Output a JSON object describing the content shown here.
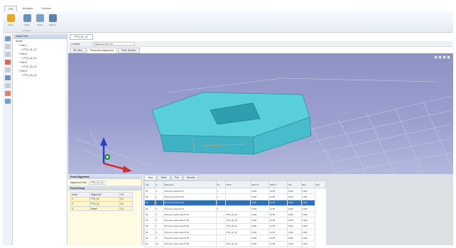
{
  "ribbon": {
    "tabs": [
      "File",
      "Analysis",
      "Options"
    ],
    "buttons": [
      {
        "label": "Open",
        "icon": "folder-icon",
        "color": "#e4a62c"
      },
      {
        "label": "Mesh",
        "icon": "mesh-icon",
        "color": "#6b8fbf"
      },
      {
        "label": "Solve",
        "icon": "solve-icon",
        "color": "#7aa0c7"
      },
      {
        "label": "Report",
        "icon": "report-icon",
        "color": "#5c7fb0"
      }
    ],
    "group_label": "Analysis"
  },
  "tree": {
    "header": "Model Tree",
    "nodes": [
      {
        "label": "Model",
        "indent": 0
      },
      {
        "label": "+ Part 1",
        "indent": 1
      },
      {
        "label": "+ PTS_01_12",
        "indent": 2
      },
      {
        "label": "+ Part 2",
        "indent": 1
      },
      {
        "label": "+ PTS_02_12",
        "indent": 2
      },
      {
        "label": "+ Part 3",
        "indent": 1
      },
      {
        "label": "+ PTS_03_12",
        "indent": 2
      },
      {
        "label": "+ Part 4",
        "indent": 1
      },
      {
        "label": "+ PTS_04_12",
        "indent": 2
      }
    ]
  },
  "document": {
    "tab_title": "PTS_01_12",
    "breadcrumb_label": "Location",
    "breadcrumb_value": "Placement PTS_01",
    "view_tabs": [
      "3D View",
      "Placement Alignment",
      "Fiber Section"
    ],
    "active_view_tab": 1
  },
  "viewport": {
    "object_color": "#49c6d3",
    "background": "#9a9fce"
  },
  "properties": {
    "section1_title": "Point Alignment",
    "row_label": "Alignment Point",
    "row_value": "PTS_01_12",
    "section2_title": "Point Group",
    "table_header": [
      "Index",
      "Alignment",
      "Off"
    ],
    "table_rows": [
      [
        "1",
        "PTS_01",
        "0.0"
      ],
      [
        "2",
        "PTS_02",
        "0.0"
      ],
      [
        "3",
        "Reset",
        "0.0"
      ]
    ]
  },
  "grid": {
    "tabs": [
      "Data",
      "Table",
      "Plot",
      "Results"
    ],
    "columns": [
      "Cat",
      "#",
      "Alignment",
      "Idx",
      "Point",
      "Offset X",
      "Offset Y",
      "Vert",
      "Elev",
      "Rot"
    ],
    "rows": [
      [
        "PA",
        "1",
        "Pressure vessel Pt 01",
        "1",
        "",
        "0.000",
        "12.55",
        "0.000",
        "0.000"
      ],
      [
        "PA",
        "2",
        "Pressure vessel Pt 02",
        "2",
        "",
        "0.000",
        "12.55",
        "0.000",
        "0.000"
      ],
      [
        "PA",
        "3",
        "Pressure vessel Pt 03",
        "3",
        "",
        "0.000",
        "12.55",
        "0.000",
        "0.000"
      ],
      [
        "PA",
        "4",
        "Pressure vessel Pt 04",
        "4",
        "",
        "0.000",
        "12.55",
        "0.000",
        "0.000"
      ],
      [
        "PA",
        "5",
        "Pressure vessel outer Pt 01",
        "",
        "PTS_01_12",
        "0.000",
        "12.55",
        "0.000",
        "0.000"
      ],
      [
        "PA",
        "6",
        "Pressure vessel outer Pt 02",
        "",
        "PTS_02_12",
        "0.000",
        "12.55",
        "0.000",
        "0.000"
      ],
      [
        "PA",
        "7",
        "Pressure vessel outer Pt 03",
        "",
        "PTS_03_12",
        "0.000",
        "12.55",
        "0.000",
        "0.000"
      ],
      [
        "PA",
        "8",
        "Pressure vessel outer Pt 04",
        "",
        "PTS_04_12",
        "0.000",
        "12.55",
        "0.000",
        "0.000"
      ],
      [
        "PA",
        "9",
        "Pressure vessel outer Pt 05",
        "",
        "",
        "0.000",
        "12.55",
        "0.000",
        "0.000"
      ],
      [
        "PA",
        "10",
        "Pressure vessel outer Pt 06",
        "",
        "PTS_06_12",
        "0.000",
        "12.55",
        "0.000",
        "0.000"
      ]
    ],
    "selected_row": 2
  }
}
